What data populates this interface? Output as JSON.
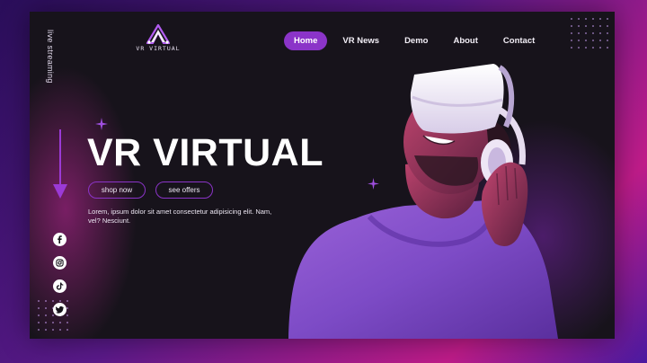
{
  "brand": {
    "name": "VR VIRTUAL"
  },
  "nav": {
    "items": [
      {
        "label": "Home",
        "active": true
      },
      {
        "label": "VR News",
        "active": false
      },
      {
        "label": "Demo",
        "active": false
      },
      {
        "label": "About",
        "active": false
      },
      {
        "label": "Contact",
        "active": false
      }
    ]
  },
  "sidebar": {
    "vertical_text": "live streaming"
  },
  "hero": {
    "title": "VR VIRTUAL",
    "shop_label": "shop now",
    "offers_label": "see offers",
    "description": "Lorem, ipsum dolor sit amet consectetur adipisicing elit. Nam, vel? Nesciunt."
  },
  "social": [
    "facebook-icon",
    "instagram-icon",
    "tiktok-icon",
    "twitter-icon"
  ],
  "colors": {
    "accent": "#8b34c8",
    "background": "#17131b",
    "text": "#ffffff"
  }
}
